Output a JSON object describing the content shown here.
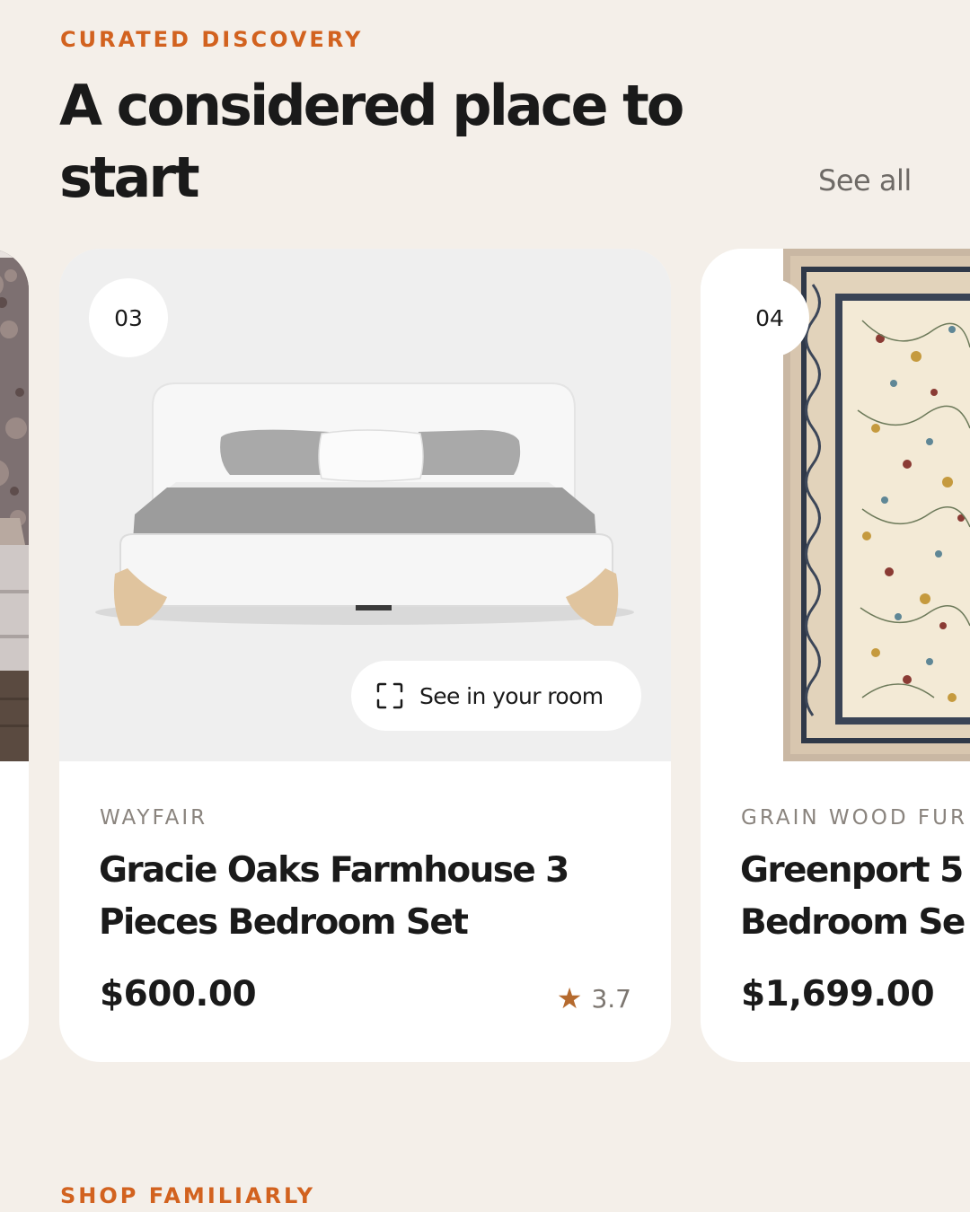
{
  "section": {
    "eyebrow": "CURATED DISCOVERY",
    "title_line1": "A considered place to",
    "title_line2": "start",
    "see_all": "See all"
  },
  "cards": [
    {
      "index": "03",
      "image": "white boucle upholstered bed with oak legs",
      "ar_button": "See in your room",
      "ar_icon": "scan-frame-icon",
      "brand": "WAYFAIR",
      "name_line1": "Gracie Oaks Farmhouse 3",
      "name_line2": "Pieces Bedroom Set",
      "price": "$600.00",
      "rating": "3.7",
      "rating_icon": "star-icon"
    },
    {
      "index": "04",
      "image": "cream persian floral area rug",
      "brand": "GRAIN WOOD FUR",
      "name_line1": "Greenport 5",
      "name_line2": "Bedroom Se",
      "price": "$1,699.00"
    }
  ],
  "next_section": {
    "eyebrow": "SHOP FAMILIARLY"
  },
  "colors": {
    "background": "#f4efe9",
    "accent": "#d2621f",
    "card": "#ffffff",
    "star": "#b56a2e"
  }
}
